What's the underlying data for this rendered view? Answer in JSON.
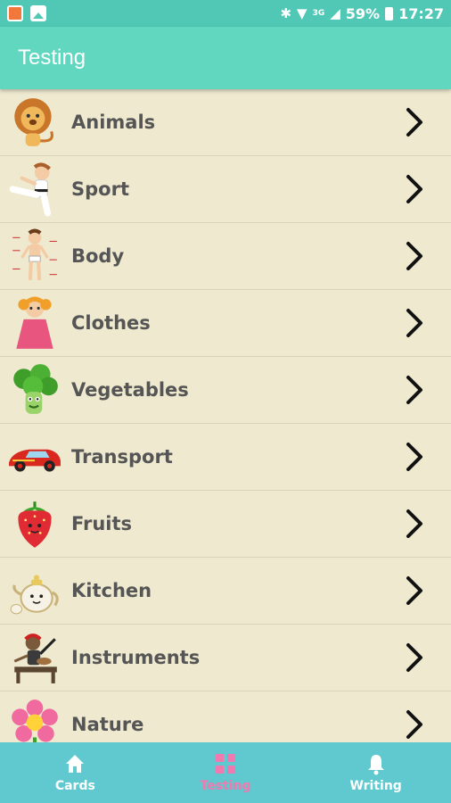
{
  "status_bar": {
    "network": "3G",
    "battery": "59%",
    "time": "17:27"
  },
  "app_bar": {
    "title": "Testing"
  },
  "categories": [
    {
      "label": "Animals",
      "icon": "lion-icon"
    },
    {
      "label": "Sport",
      "icon": "karate-kid-icon"
    },
    {
      "label": "Body",
      "icon": "body-chart-icon"
    },
    {
      "label": "Clothes",
      "icon": "girl-dress-icon"
    },
    {
      "label": "Vegetables",
      "icon": "broccoli-icon"
    },
    {
      "label": "Transport",
      "icon": "race-car-icon"
    },
    {
      "label": "Fruits",
      "icon": "strawberry-icon"
    },
    {
      "label": "Kitchen",
      "icon": "teapot-icon"
    },
    {
      "label": "Instruments",
      "icon": "drummer-icon"
    },
    {
      "label": "Nature",
      "icon": "flower-icon"
    }
  ],
  "bottom_nav": {
    "items": [
      {
        "label": "Cards",
        "icon": "home-icon"
      },
      {
        "label": "Testing",
        "icon": "grid-icon",
        "active": true
      },
      {
        "label": "Writing",
        "icon": "bell-icon"
      }
    ]
  },
  "colors": {
    "status_bar": "#51c8b5",
    "app_bar": "#62d7bf",
    "list_background": "#efe9cf",
    "bottom_nav": "#5fc9cf",
    "active_tab": "#f07ab0"
  }
}
